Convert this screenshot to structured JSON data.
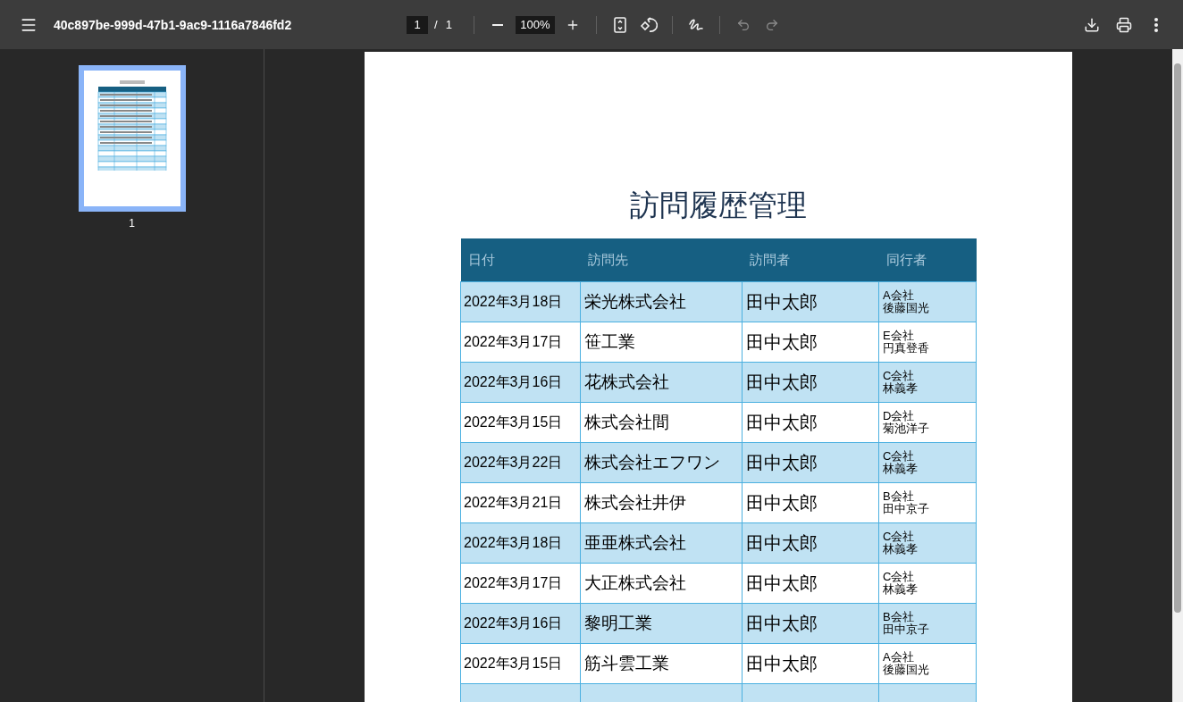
{
  "toolbar": {
    "title": "40c897be-999d-47b1-9ac9-1116a7846fd2",
    "page_input": "1",
    "page_separator": "/",
    "page_count": "1",
    "zoom": "100%",
    "undo_disabled": true,
    "redo_disabled": true
  },
  "sidebar": {
    "thumbnails": [
      {
        "label": "1",
        "selected": true
      }
    ]
  },
  "document": {
    "title": "訪問履歴管理",
    "table": {
      "columns": [
        "日付",
        "訪問先",
        "訪問者",
        "同行者"
      ],
      "rows": [
        {
          "cells": [
            "2022年3月18日",
            "栄光株式会社",
            "田中太郎"
          ],
          "companion": {
            "company": "A会社",
            "name": "後藤国光"
          }
        },
        {
          "cells": [
            "2022年3月17日",
            "笹工業",
            "田中太郎"
          ],
          "companion": {
            "company": "E会社",
            "name": "円真登香"
          }
        },
        {
          "cells": [
            "2022年3月16日",
            "花株式会社",
            "田中太郎"
          ],
          "companion": {
            "company": "C会社",
            "name": "林義孝"
          }
        },
        {
          "cells": [
            "2022年3月15日",
            "株式会社間",
            "田中太郎"
          ],
          "companion": {
            "company": "D会社",
            "name": "菊池洋子"
          }
        },
        {
          "cells": [
            "2022年3月22日",
            "株式会社エフワン",
            "田中太郎"
          ],
          "companion": {
            "company": "C会社",
            "name": "林義孝"
          }
        },
        {
          "cells": [
            "2022年3月21日",
            "株式会社井伊",
            "田中太郎"
          ],
          "companion": {
            "company": "B会社",
            "name": "田中京子"
          }
        },
        {
          "cells": [
            "2022年3月18日",
            "亜亜株式会社",
            "田中太郎"
          ],
          "companion": {
            "company": "C会社",
            "name": "林義孝"
          }
        },
        {
          "cells": [
            "2022年3月17日",
            "大正株式会社",
            "田中太郎"
          ],
          "companion": {
            "company": "C会社",
            "name": "林義孝"
          }
        },
        {
          "cells": [
            "2022年3月16日",
            "黎明工業",
            "田中太郎"
          ],
          "companion": {
            "company": "B会社",
            "name": "田中京子"
          }
        },
        {
          "cells": [
            "2022年3月15日",
            "筋斗雲工業",
            "田中太郎"
          ],
          "companion": {
            "company": "A会社",
            "name": "後藤国光"
          }
        }
      ]
    }
  }
}
